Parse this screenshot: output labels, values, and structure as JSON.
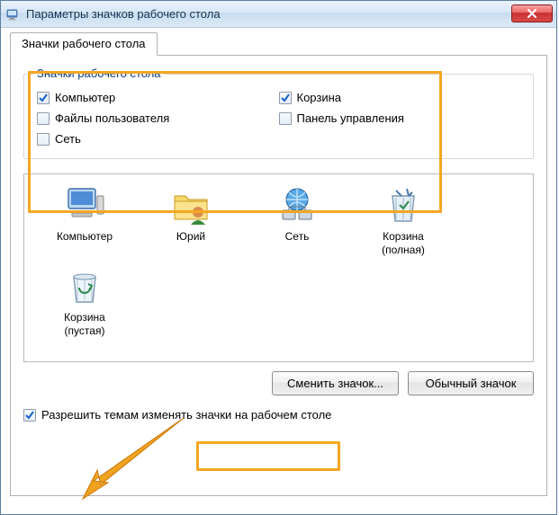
{
  "window": {
    "title": "Параметры значков рабочего стола"
  },
  "tab": {
    "label": "Значки рабочего стола"
  },
  "groupbox": {
    "legend": "Значки рабочего стола",
    "checks": [
      {
        "label": "Компьютер",
        "checked": true
      },
      {
        "label": "Корзина",
        "checked": true
      },
      {
        "label": "Файлы пользователя",
        "checked": false
      },
      {
        "label": "Панель управления",
        "checked": false
      },
      {
        "label": "Сеть",
        "checked": false
      }
    ]
  },
  "icons": [
    {
      "label": "Компьютер",
      "kind": "computer"
    },
    {
      "label": "Юрий",
      "kind": "user-folder"
    },
    {
      "label": "Сеть",
      "kind": "network"
    },
    {
      "label": "Корзина\n(полная)",
      "kind": "recycle-full"
    },
    {
      "label": "Корзина\n(пустая)",
      "kind": "recycle-empty"
    }
  ],
  "buttons": {
    "change": "Сменить значок...",
    "restore": "Обычный значок"
  },
  "allow_themes": {
    "label": "Разрешить темам изменять значки на рабочем столе",
    "checked": true
  }
}
